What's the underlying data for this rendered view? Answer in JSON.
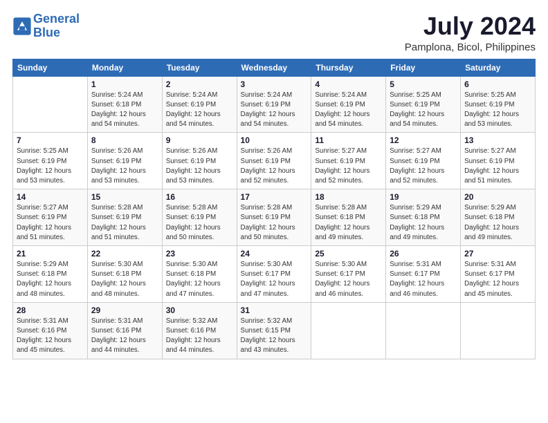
{
  "header": {
    "logo_line1": "General",
    "logo_line2": "Blue",
    "month_year": "July 2024",
    "location": "Pamplona, Bicol, Philippines"
  },
  "weekdays": [
    "Sunday",
    "Monday",
    "Tuesday",
    "Wednesday",
    "Thursday",
    "Friday",
    "Saturday"
  ],
  "weeks": [
    [
      {
        "day": "",
        "info": ""
      },
      {
        "day": "1",
        "info": "Sunrise: 5:24 AM\nSunset: 6:18 PM\nDaylight: 12 hours\nand 54 minutes."
      },
      {
        "day": "2",
        "info": "Sunrise: 5:24 AM\nSunset: 6:19 PM\nDaylight: 12 hours\nand 54 minutes."
      },
      {
        "day": "3",
        "info": "Sunrise: 5:24 AM\nSunset: 6:19 PM\nDaylight: 12 hours\nand 54 minutes."
      },
      {
        "day": "4",
        "info": "Sunrise: 5:24 AM\nSunset: 6:19 PM\nDaylight: 12 hours\nand 54 minutes."
      },
      {
        "day": "5",
        "info": "Sunrise: 5:25 AM\nSunset: 6:19 PM\nDaylight: 12 hours\nand 54 minutes."
      },
      {
        "day": "6",
        "info": "Sunrise: 5:25 AM\nSunset: 6:19 PM\nDaylight: 12 hours\nand 53 minutes."
      }
    ],
    [
      {
        "day": "7",
        "info": "Sunrise: 5:25 AM\nSunset: 6:19 PM\nDaylight: 12 hours\nand 53 minutes."
      },
      {
        "day": "8",
        "info": "Sunrise: 5:26 AM\nSunset: 6:19 PM\nDaylight: 12 hours\nand 53 minutes."
      },
      {
        "day": "9",
        "info": "Sunrise: 5:26 AM\nSunset: 6:19 PM\nDaylight: 12 hours\nand 53 minutes."
      },
      {
        "day": "10",
        "info": "Sunrise: 5:26 AM\nSunset: 6:19 PM\nDaylight: 12 hours\nand 52 minutes."
      },
      {
        "day": "11",
        "info": "Sunrise: 5:27 AM\nSunset: 6:19 PM\nDaylight: 12 hours\nand 52 minutes."
      },
      {
        "day": "12",
        "info": "Sunrise: 5:27 AM\nSunset: 6:19 PM\nDaylight: 12 hours\nand 52 minutes."
      },
      {
        "day": "13",
        "info": "Sunrise: 5:27 AM\nSunset: 6:19 PM\nDaylight: 12 hours\nand 51 minutes."
      }
    ],
    [
      {
        "day": "14",
        "info": "Sunrise: 5:27 AM\nSunset: 6:19 PM\nDaylight: 12 hours\nand 51 minutes."
      },
      {
        "day": "15",
        "info": "Sunrise: 5:28 AM\nSunset: 6:19 PM\nDaylight: 12 hours\nand 51 minutes."
      },
      {
        "day": "16",
        "info": "Sunrise: 5:28 AM\nSunset: 6:19 PM\nDaylight: 12 hours\nand 50 minutes."
      },
      {
        "day": "17",
        "info": "Sunrise: 5:28 AM\nSunset: 6:19 PM\nDaylight: 12 hours\nand 50 minutes."
      },
      {
        "day": "18",
        "info": "Sunrise: 5:28 AM\nSunset: 6:18 PM\nDaylight: 12 hours\nand 49 minutes."
      },
      {
        "day": "19",
        "info": "Sunrise: 5:29 AM\nSunset: 6:18 PM\nDaylight: 12 hours\nand 49 minutes."
      },
      {
        "day": "20",
        "info": "Sunrise: 5:29 AM\nSunset: 6:18 PM\nDaylight: 12 hours\nand 49 minutes."
      }
    ],
    [
      {
        "day": "21",
        "info": "Sunrise: 5:29 AM\nSunset: 6:18 PM\nDaylight: 12 hours\nand 48 minutes."
      },
      {
        "day": "22",
        "info": "Sunrise: 5:30 AM\nSunset: 6:18 PM\nDaylight: 12 hours\nand 48 minutes."
      },
      {
        "day": "23",
        "info": "Sunrise: 5:30 AM\nSunset: 6:18 PM\nDaylight: 12 hours\nand 47 minutes."
      },
      {
        "day": "24",
        "info": "Sunrise: 5:30 AM\nSunset: 6:17 PM\nDaylight: 12 hours\nand 47 minutes."
      },
      {
        "day": "25",
        "info": "Sunrise: 5:30 AM\nSunset: 6:17 PM\nDaylight: 12 hours\nand 46 minutes."
      },
      {
        "day": "26",
        "info": "Sunrise: 5:31 AM\nSunset: 6:17 PM\nDaylight: 12 hours\nand 46 minutes."
      },
      {
        "day": "27",
        "info": "Sunrise: 5:31 AM\nSunset: 6:17 PM\nDaylight: 12 hours\nand 45 minutes."
      }
    ],
    [
      {
        "day": "28",
        "info": "Sunrise: 5:31 AM\nSunset: 6:16 PM\nDaylight: 12 hours\nand 45 minutes."
      },
      {
        "day": "29",
        "info": "Sunrise: 5:31 AM\nSunset: 6:16 PM\nDaylight: 12 hours\nand 44 minutes."
      },
      {
        "day": "30",
        "info": "Sunrise: 5:32 AM\nSunset: 6:16 PM\nDaylight: 12 hours\nand 44 minutes."
      },
      {
        "day": "31",
        "info": "Sunrise: 5:32 AM\nSunset: 6:15 PM\nDaylight: 12 hours\nand 43 minutes."
      },
      {
        "day": "",
        "info": ""
      },
      {
        "day": "",
        "info": ""
      },
      {
        "day": "",
        "info": ""
      }
    ]
  ]
}
